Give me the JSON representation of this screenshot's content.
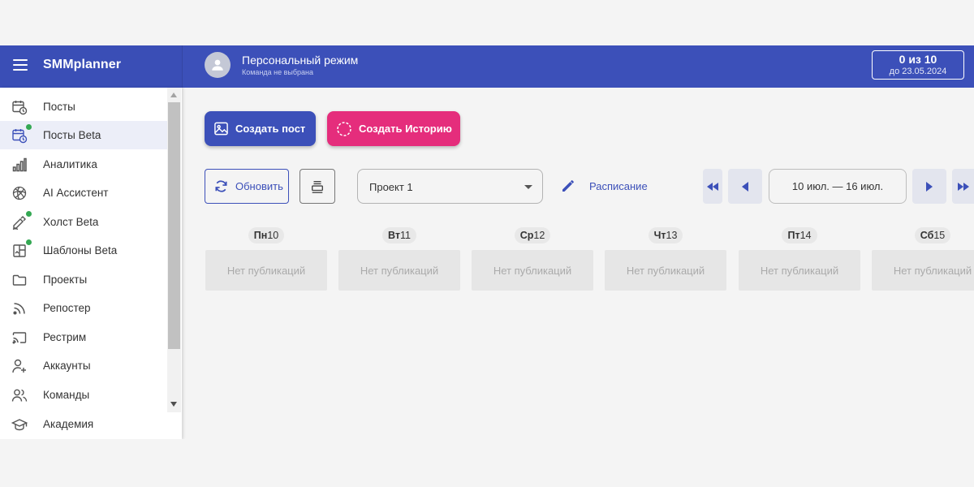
{
  "header": {
    "brand": "SMMplanner",
    "user_title": "Персональный режим",
    "user_subtitle": "Команда не выбрана",
    "quota_main": "0 из 10",
    "quota_sub": "до 23.05.2024",
    "color": "#3c50b9"
  },
  "sidebar": {
    "items": [
      {
        "label": "Посты",
        "icon": "calendar-clock-icon",
        "badge": false,
        "active": false
      },
      {
        "label": "Посты Beta",
        "icon": "calendar-clock-icon",
        "badge": true,
        "active": true
      },
      {
        "label": "Аналитика",
        "icon": "bar-chart-icon",
        "badge": false,
        "active": false
      },
      {
        "label": "AI Ассистент",
        "icon": "ai-knot-icon",
        "badge": false,
        "active": false
      },
      {
        "label": "Холст Beta",
        "icon": "canvas-icon",
        "badge": true,
        "active": false
      },
      {
        "label": "Шаблоны Beta",
        "icon": "template-icon",
        "badge": true,
        "active": false
      },
      {
        "label": "Проекты",
        "icon": "folder-icon",
        "badge": false,
        "active": false
      },
      {
        "label": "Репостер",
        "icon": "rss-icon",
        "badge": false,
        "active": false
      },
      {
        "label": "Рестрим",
        "icon": "cast-icon",
        "badge": false,
        "active": false
      },
      {
        "label": "Аккаунты",
        "icon": "user-plus-icon",
        "badge": false,
        "active": false
      },
      {
        "label": "Команды",
        "icon": "users-icon",
        "badge": false,
        "active": false
      },
      {
        "label": "Академия",
        "icon": "graduation-cap-icon",
        "badge": false,
        "active": false
      }
    ]
  },
  "actions": {
    "create_post": "Создать пост",
    "create_story": "Создать Историю",
    "refresh": "Обновить",
    "schedule": "Расписание",
    "story_color": "#e52d7c"
  },
  "project_select": {
    "value": "Проект 1"
  },
  "date_range": "10 июл. — 16 июл.",
  "days": [
    {
      "dow": "Пн",
      "num": "10",
      "empty": "Нет публикаций"
    },
    {
      "dow": "Вт",
      "num": "11",
      "empty": "Нет публикаций"
    },
    {
      "dow": "Ср",
      "num": "12",
      "empty": "Нет публикаций"
    },
    {
      "dow": "Чт",
      "num": "13",
      "empty": "Нет публикаций"
    },
    {
      "dow": "Пт",
      "num": "14",
      "empty": "Нет публикаций"
    },
    {
      "dow": "Сб",
      "num": "15",
      "empty": "Нет публикаций"
    }
  ]
}
